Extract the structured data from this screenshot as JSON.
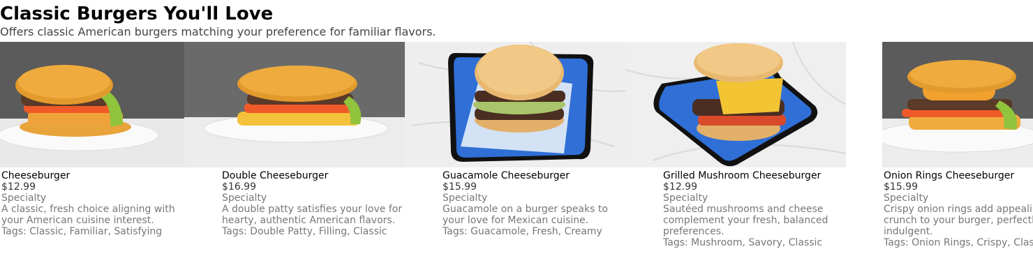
{
  "section": {
    "title": "Classic Burgers You'll Love",
    "subtitle": "Offers classic American burgers matching your preference for familiar flavors."
  },
  "items": [
    {
      "name": "Cheeseburger",
      "price": "$12.99",
      "category": "Specialty",
      "description": "A classic, fresh choice aligning with your American cuisine interest.",
      "tags": "Tags: Classic, Familiar, Satisfying",
      "photo_icon": "cheeseburger-photo"
    },
    {
      "name": "Double Cheeseburger",
      "price": "$16.99",
      "category": "Specialty",
      "description": "A double patty satisfies your love for hearty, authentic American flavors.",
      "tags": "Tags: Double Patty, Filling, Classic",
      "photo_icon": "double-cheeseburger-photo"
    },
    {
      "name": "Guacamole Cheeseburger",
      "price": "$15.99",
      "category": "Specialty",
      "description": "Guacamole on a burger speaks to your love for Mexican cuisine.",
      "tags": "Tags: Guacamole, Fresh, Creamy",
      "photo_icon": "guacamole-cheeseburger-photo"
    },
    {
      "name": "Grilled Mushroom Cheeseburger",
      "price": "$12.99",
      "category": "Specialty",
      "description": "Sautéed mushrooms and cheese complement your fresh, balanced preferences.",
      "tags": "Tags: Mushroom, Savory, Classic",
      "photo_icon": "mushroom-cheeseburger-photo"
    },
    {
      "name": "Onion Rings Cheeseburger",
      "price": "$15.99",
      "category": "Specialty",
      "description": "Crispy onion rings add appealing crunch to your burger, perfectly indulgent.",
      "tags": "Tags: Onion Rings, Crispy, Classic",
      "photo_icon": "onion-rings-cheeseburger-photo"
    }
  ],
  "colors": {
    "bun": "#e8a33a",
    "patty": "#5a3a28",
    "plate_blue": "#2f6fd6",
    "backdrop_dark": "#5b5b5b",
    "marble": "#eeeeee"
  }
}
